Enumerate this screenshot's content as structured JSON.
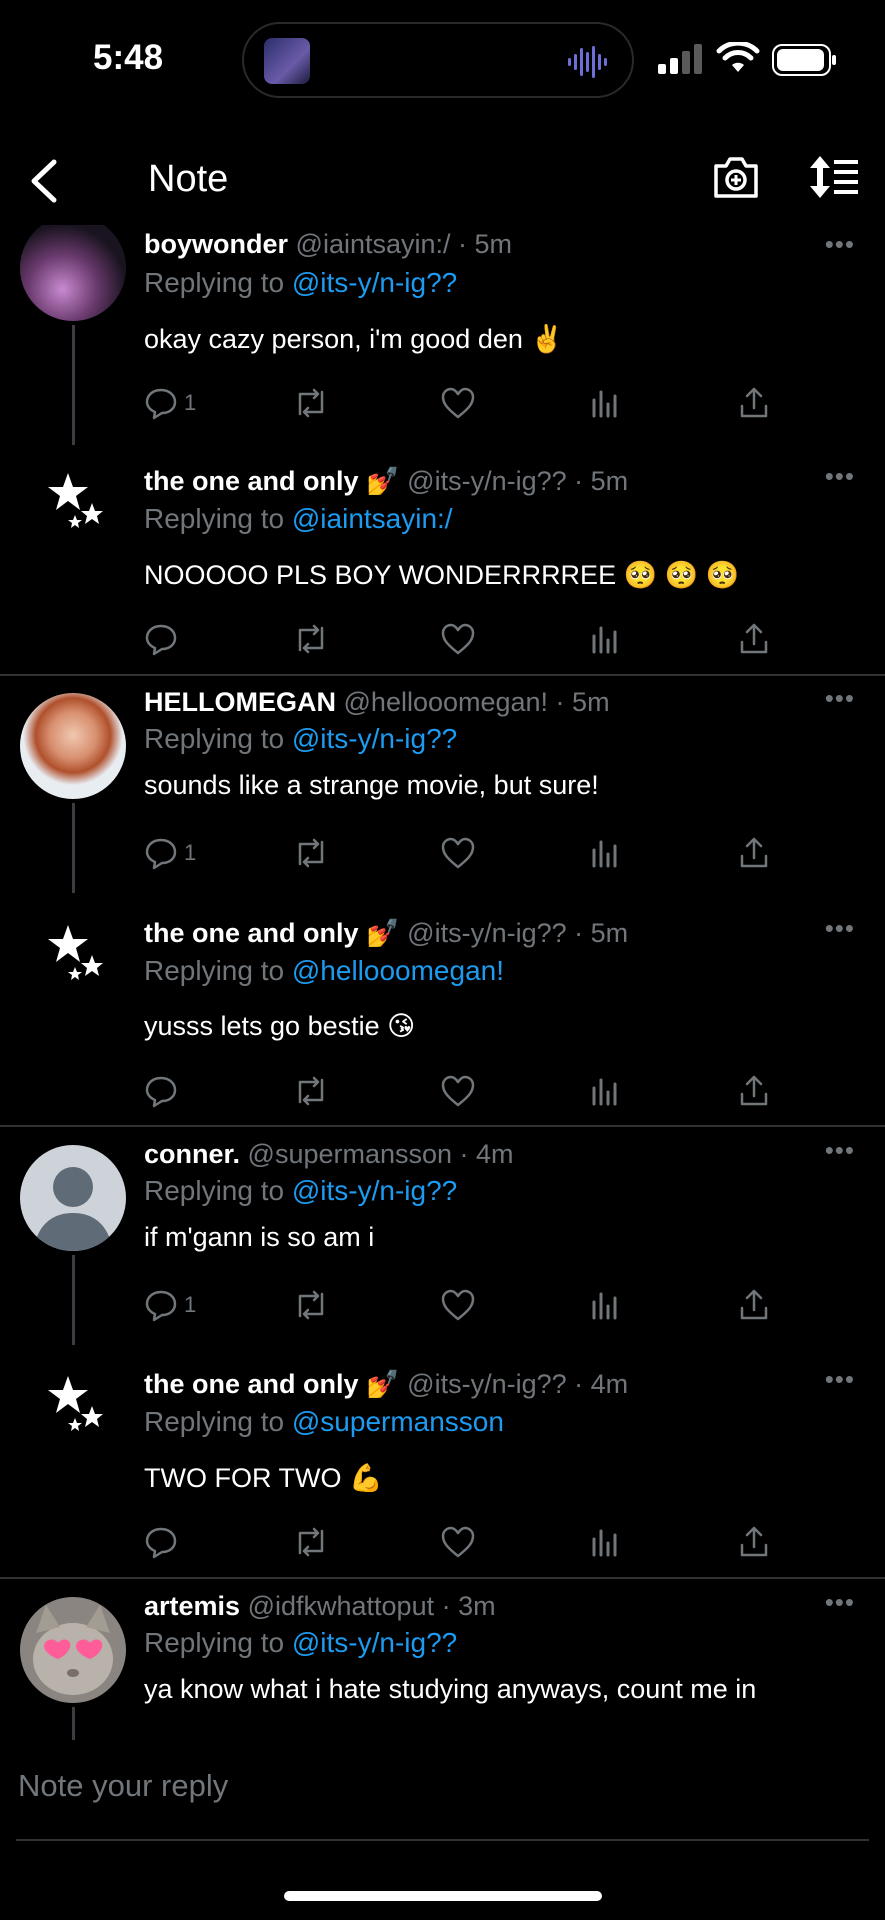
{
  "status_bar": {
    "time": "5:48"
  },
  "header": {
    "title": "Note",
    "back_icon": "chevron-left-icon",
    "camera_icon": "camera-add-icon",
    "sort_icon": "sort-lines-icon"
  },
  "tweets": [
    {
      "name": "boywonder",
      "emoji": "",
      "meta": "@iaintsayin:/ · 5m",
      "reply_prefix": "Replying to ",
      "reply_to": "@its-y/n-ig??",
      "text": "okay cazy person, i'm good den ✌️",
      "reply_count": "1"
    },
    {
      "name": "the one and only",
      "emoji": "💅",
      "meta": "@its-y/n-ig?? · 5m",
      "reply_prefix": "Replying to ",
      "reply_to": "@iaintsayin:/",
      "text": "NOOOOO PLS BOY WONDERRRREE 🥺 🥺 🥺",
      "reply_count": ""
    },
    {
      "name": "HELLOMEGAN",
      "emoji": "",
      "meta": "@hellooomegan! · 5m",
      "reply_prefix": "Replying to ",
      "reply_to": "@its-y/n-ig??",
      "text": "sounds like a strange movie, but sure!",
      "reply_count": "1"
    },
    {
      "name": "the one and only",
      "emoji": "💅",
      "meta": "@its-y/n-ig?? · 5m",
      "reply_prefix": "Replying to ",
      "reply_to": "@hellooomegan!",
      "text": "yusss lets go bestie 😘",
      "reply_count": ""
    },
    {
      "name": "conner.",
      "emoji": "",
      "meta": "@supermansson · 4m",
      "reply_prefix": "Replying to ",
      "reply_to": "@its-y/n-ig??",
      "text": "if m'gann is so am i",
      "reply_count": "1"
    },
    {
      "name": "the one and only",
      "emoji": "💅",
      "meta": "@its-y/n-ig?? · 4m",
      "reply_prefix": "Replying to ",
      "reply_to": "@supermansson",
      "text": "TWO FOR TWO 💪",
      "reply_count": ""
    },
    {
      "name": "artemis",
      "emoji": "",
      "meta": "@idfkwhattoput · 3m",
      "reply_prefix": "Replying to ",
      "reply_to": "@its-y/n-ig??",
      "text": "ya know what i hate studying anyways, count me in",
      "reply_count": ""
    }
  ],
  "more_label": "•••",
  "composer": {
    "placeholder": "Note your reply"
  },
  "colors": {
    "background": "#000000",
    "accent": "#1d9bf0",
    "secondary_text": "#71767b",
    "divider": "#2f3336"
  }
}
